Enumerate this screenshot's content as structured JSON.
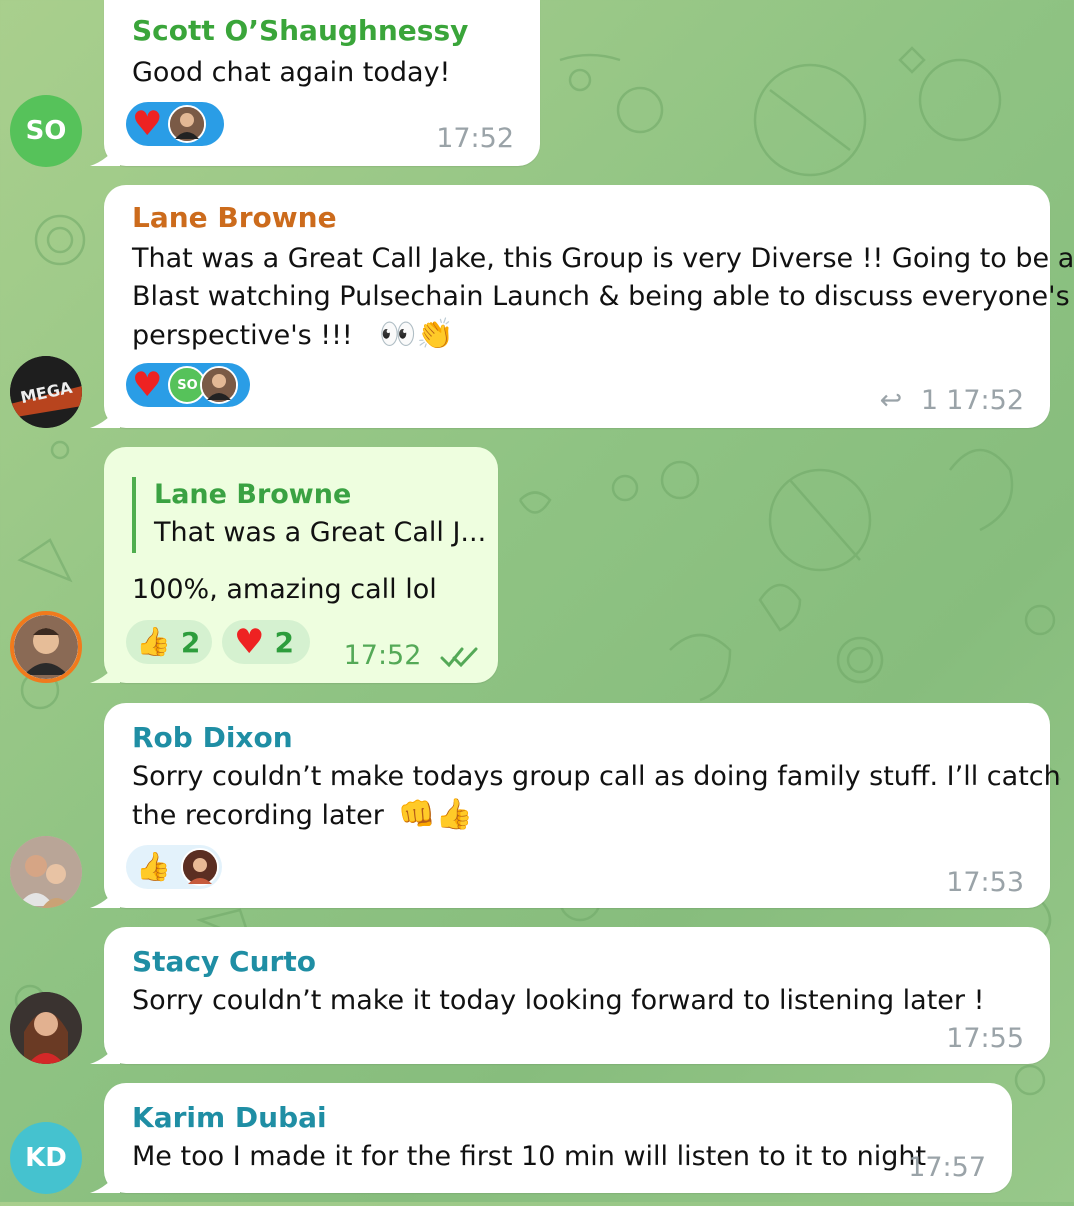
{
  "colors": {
    "scott": "#3aa53a",
    "lane": "#cc6b1c",
    "teal": "#1f8ea4",
    "so_avatar": "#56c25a",
    "kd_avatar": "#45c2cf",
    "reaction_blue": "#2a9de6"
  },
  "messages": [
    {
      "sender": "Scott O’Shaughnessy",
      "text": "Good chat again today!",
      "time": "17:52",
      "avatar_initials": "SO"
    },
    {
      "sender": "Lane Browne",
      "lines": [
        "That was a Great Call Jake, this Group is very Diverse !! Going to be a",
        "Blast watching Pulsechain Launch & being able to discuss everyone's",
        "perspective's !!!"
      ],
      "emojis": "👀👏",
      "reply_count": "1",
      "time": "17:52",
      "reaction_avatar": "SO",
      "avatar_label": "MEGA"
    },
    {
      "quote_name": "Lane Browne",
      "quote_text": "That was a Great Call J...",
      "text": "100%, amazing call lol",
      "reactions": [
        {
          "emoji": "👍",
          "count": "2"
        },
        {
          "emoji": "♥",
          "count": "2"
        }
      ],
      "time": "17:52",
      "read_icon": "double-check-icon"
    },
    {
      "sender": "Rob Dixon",
      "lines": [
        "Sorry couldn’t make todays group call as doing family stuff. I’ll catch",
        "the recording later"
      ],
      "emojis": "👊👍",
      "reaction_emoji": "👍",
      "time": "17:53"
    },
    {
      "sender": "Stacy Curto",
      "text": "Sorry couldn’t make it today looking forward to listening later !",
      "time": "17:55"
    },
    {
      "sender": "Karim Dubai",
      "text": "Me too I made it for the first 10 min will listen to it to night",
      "time": "17:57",
      "avatar_initials": "KD"
    }
  ]
}
